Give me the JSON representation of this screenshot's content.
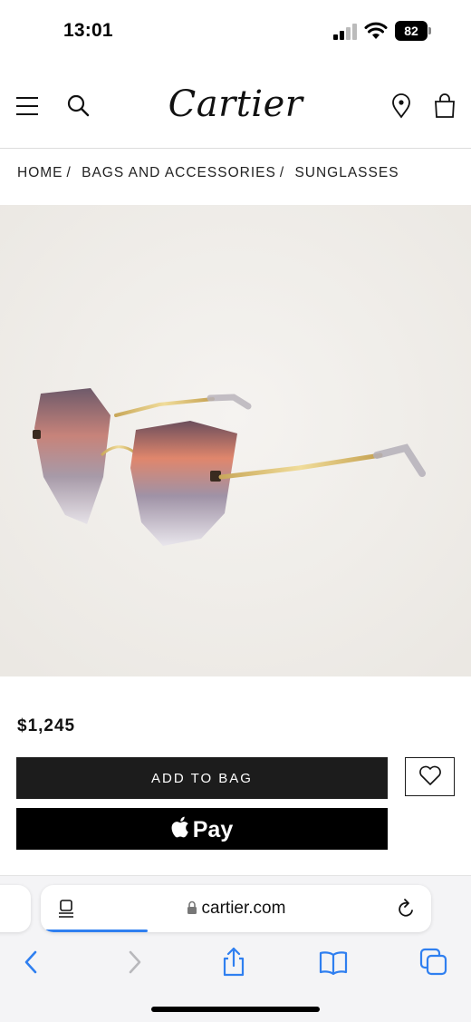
{
  "status_bar": {
    "time": "13:01",
    "battery": "82"
  },
  "header": {
    "brand": "Cartier",
    "icons": [
      "menu-icon",
      "search-icon",
      "location-pin-icon",
      "shopping-bag-icon"
    ]
  },
  "breadcrumb": [
    {
      "label": "HOME"
    },
    {
      "label": "BAGS AND ACCESSORIES"
    },
    {
      "label": "SUNGLASSES"
    }
  ],
  "product": {
    "price": "$1,245",
    "add_to_bag_label": "ADD TO BAG",
    "apple_pay_label": "Pay",
    "image_icon": "next-image-chevron-icon"
  },
  "browser": {
    "url": "cartier.com",
    "load_progress": 0.27,
    "toolbar_icons": [
      "back-icon",
      "forward-icon",
      "share-icon",
      "bookmarks-icon",
      "tabs-icon"
    ]
  },
  "colors": {
    "accent_blue": "#2f7ff0",
    "button_dark": "#1c1c1c",
    "image_bg": "#efece8"
  }
}
